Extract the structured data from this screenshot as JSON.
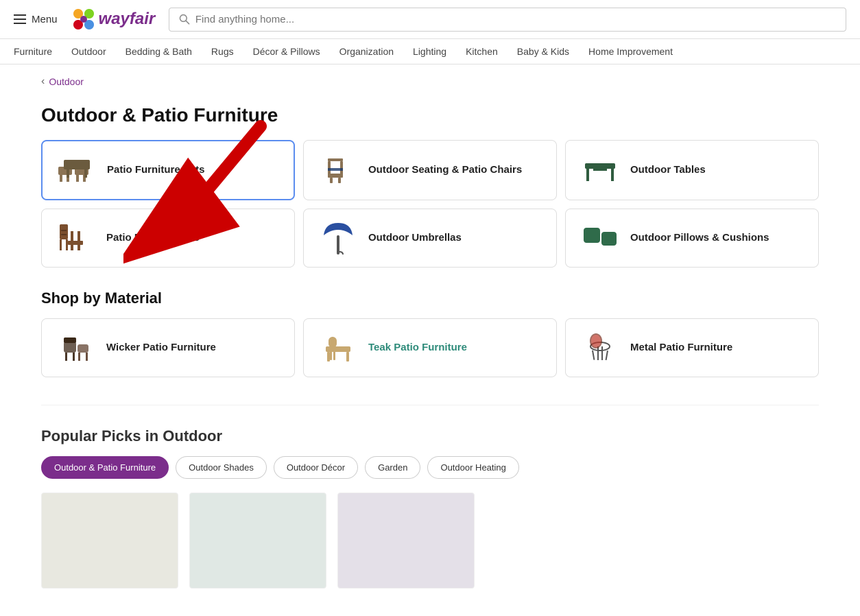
{
  "header": {
    "menu_label": "Menu",
    "logo_text": "wayfair",
    "search_placeholder": "Find anything home..."
  },
  "nav": {
    "items": [
      {
        "label": "Furniture",
        "href": "#"
      },
      {
        "label": "Outdoor",
        "href": "#"
      },
      {
        "label": "Bedding & Bath",
        "href": "#"
      },
      {
        "label": "Rugs",
        "href": "#"
      },
      {
        "label": "Décor & Pillows",
        "href": "#"
      },
      {
        "label": "Organization",
        "href": "#"
      },
      {
        "label": "Lighting",
        "href": "#"
      },
      {
        "label": "Kitchen",
        "href": "#"
      },
      {
        "label": "Baby & Kids",
        "href": "#"
      },
      {
        "label": "Home Improvement",
        "href": "#"
      }
    ]
  },
  "breadcrumb": {
    "parent": "Outdoor",
    "chevron": "‹"
  },
  "page_title": "Outdoor & Patio Furniture",
  "categories": [
    {
      "id": "patio-sets",
      "label": "Patio Furniture Sets",
      "selected": true,
      "teal": false
    },
    {
      "id": "outdoor-seating",
      "label": "Outdoor Seating & Patio Chairs",
      "selected": false,
      "teal": false
    },
    {
      "id": "outdoor-tables",
      "label": "Outdoor Tables",
      "selected": false,
      "teal": false
    },
    {
      "id": "patio-bar",
      "label": "Patio Bar Furniture",
      "selected": false,
      "teal": false
    },
    {
      "id": "outdoor-umbrellas",
      "label": "Outdoor Umbrellas",
      "selected": false,
      "teal": false
    },
    {
      "id": "outdoor-pillows",
      "label": "Outdoor Pillows & Cushions",
      "selected": false,
      "teal": false
    }
  ],
  "shop_by_material": {
    "title": "Shop by Material",
    "items": [
      {
        "id": "wicker",
        "label": "Wicker Patio Furniture",
        "selected": false,
        "teal": false
      },
      {
        "id": "teak",
        "label": "Teak Patio Furniture",
        "selected": false,
        "teal": true
      },
      {
        "id": "metal",
        "label": "Metal Patio Furniture",
        "selected": false,
        "teal": false
      }
    ]
  },
  "popular": {
    "title": "Popular Picks in Outdoor",
    "pills": [
      {
        "label": "Outdoor & Patio Furniture",
        "active": true
      },
      {
        "label": "Outdoor Shades",
        "active": false
      },
      {
        "label": "Outdoor Décor",
        "active": false
      },
      {
        "label": "Garden",
        "active": false
      },
      {
        "label": "Outdoor Heating",
        "active": false
      }
    ]
  },
  "colors": {
    "brand_purple": "#7B2D8B",
    "teal_link": "#2E8B7A",
    "selected_border": "#5B8DEF"
  }
}
